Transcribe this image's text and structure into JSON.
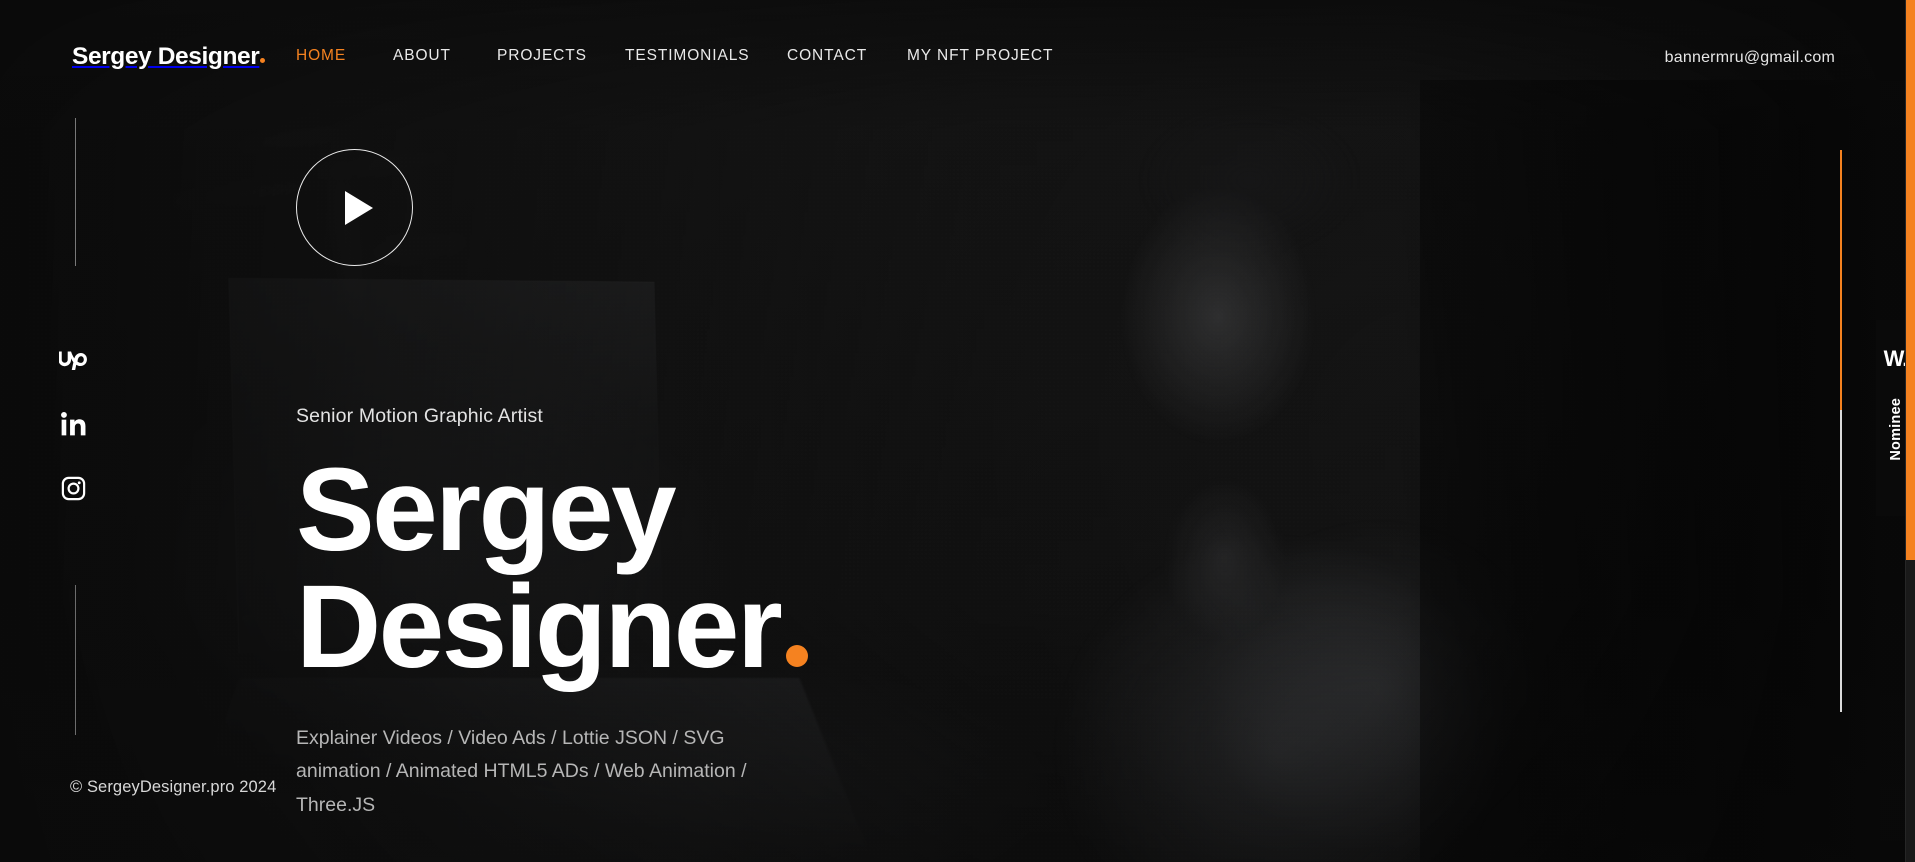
{
  "theme": {
    "accent": "#F58220",
    "background": "#121212",
    "text_primary": "#ffffff",
    "text_secondary": "#b6b6b6"
  },
  "header": {
    "brand": "Sergey Designer",
    "brand_dot": "",
    "email": "bannermru@gmail.com",
    "nav": [
      {
        "label": "HOME",
        "active": true,
        "name": "nav-home"
      },
      {
        "label": "ABOUT",
        "active": false,
        "name": "nav-about"
      },
      {
        "label": "PROJECTS",
        "active": false,
        "name": "nav-projects"
      },
      {
        "label": "TESTIMONIALS",
        "active": false,
        "name": "nav-testimonials"
      },
      {
        "label": "CONTACT",
        "active": false,
        "name": "nav-contact"
      },
      {
        "label": "MY NFT PROJECT",
        "active": false,
        "name": "nav-my-nft-project"
      }
    ]
  },
  "socials": [
    {
      "name": "upwork-icon",
      "label": "Upwork"
    },
    {
      "name": "linkedin-icon",
      "label": "LinkedIn"
    },
    {
      "name": "instagram-icon",
      "label": "Instagram"
    }
  ],
  "player": {
    "icon": "play-icon",
    "label": "Play showreel"
  },
  "hero": {
    "eyebrow": "Senior Motion Graphic Artist",
    "title_line_1": "Sergey",
    "title_line_2": "Designer",
    "title_dot": "",
    "tagline": "Explainer Videos / Video Ads / Lottie JSON / SVG animation / Animated HTML5 ADs / Web Animation / Three.JS"
  },
  "footer": {
    "copyright": "© SergeyDesigner.pro 2024"
  },
  "award": {
    "mark": "W.",
    "label": "Nominee"
  },
  "scroll": {
    "progress_percent": 46,
    "thumb_percent": 65
  }
}
